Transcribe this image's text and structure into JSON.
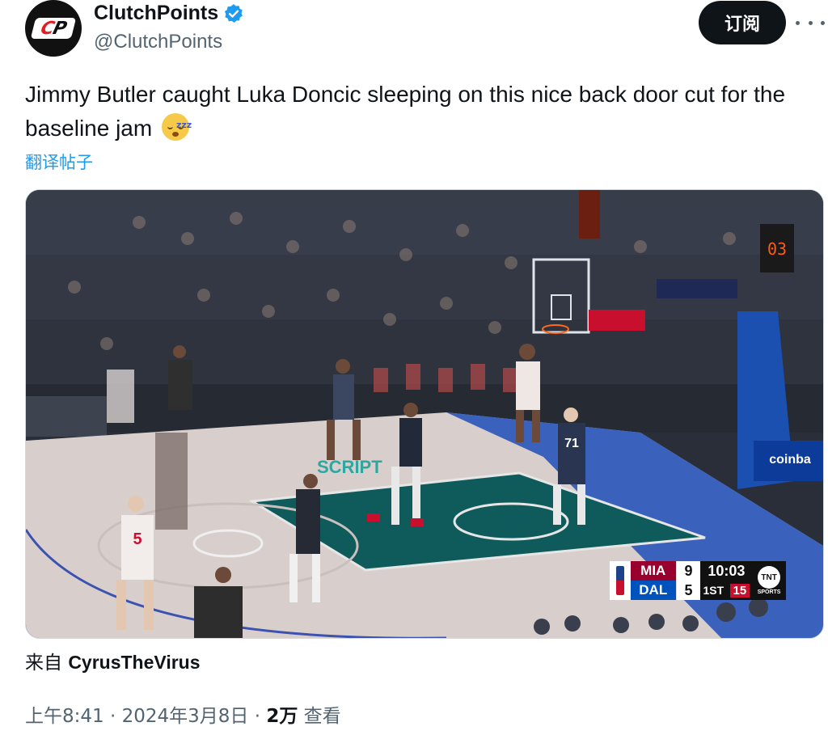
{
  "author": {
    "display_name": "ClutchPoints",
    "handle": "@ClutchPoints",
    "avatar_text_c": "C",
    "avatar_text_p": "P"
  },
  "header": {
    "subscribe_label": "订阅"
  },
  "tweet": {
    "text": "Jimmy Butler caught Luka Doncic sleeping on this nice back door cut for the baseline jam",
    "emoji_text": "zzz",
    "translate_label": "翻译帖子"
  },
  "media": {
    "court_sign_left": "SCRIPT",
    "court_sign_right": "coinba",
    "shot_clock_display": "03",
    "player_number_dal": "71",
    "player_number_mia": "5",
    "scorebug": {
      "team1": "MIA",
      "score1": "9",
      "team2": "DAL",
      "score2": "5",
      "clock": "10:03",
      "period": "1ST",
      "shot_clock": "15",
      "network": "TNT",
      "network_sub": "SPORTS"
    }
  },
  "source": {
    "prefix": "来自",
    "name": "CyrusTheVirus"
  },
  "meta": {
    "time": "上午8:41",
    "date": "2024年3月8日",
    "views_count": "2万",
    "views_label": "查看"
  },
  "colors": {
    "verified": "#1d9bf0",
    "mia": "#98002e",
    "dal": "#0053bc"
  }
}
